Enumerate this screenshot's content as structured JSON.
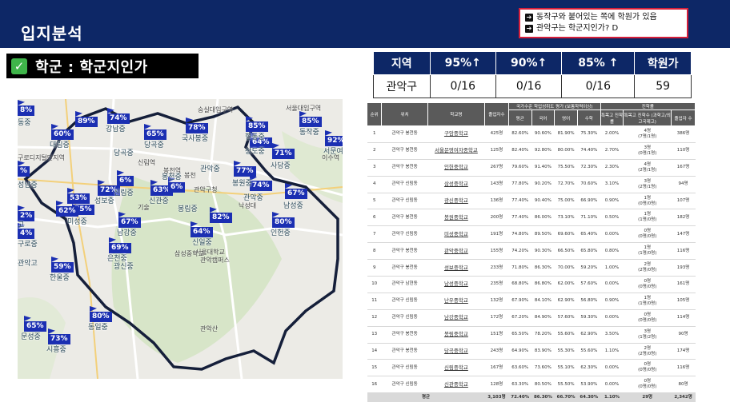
{
  "title": "입지분석",
  "notes": [
    "동작구와 붙어있는 쪽에 학원가 있음",
    "관악구는 학군지인가? D"
  ],
  "section": {
    "label": "학군 : 학군지인가"
  },
  "map": {
    "pins": [
      "8%",
      "89%",
      "74%",
      "60%",
      "65%",
      "78%",
      "85%",
      "85%",
      "92%",
      "64%",
      "71%",
      "77%",
      "72%",
      "63%",
      "6%",
      "74%",
      "67%",
      "53%",
      "75%",
      "62%",
      "67%",
      "82%",
      "80%",
      "64%",
      "69%",
      "59%",
      "65%",
      "80%",
      "73%",
      "4%",
      "2%",
      "%",
      "6%"
    ],
    "schools": [
      "동중",
      "대림중",
      "강남중",
      "당곡중",
      "국사봉중",
      "현동중",
      "성남중",
      "동작중",
      "상도중",
      "서문여",
      "사당중",
      "봉원중",
      "관악중",
      "신림중",
      "성보중",
      "신관중",
      "남성중",
      "미성중",
      "남강중",
      "구로중",
      "신일중",
      "은천중",
      "광신중",
      "인헌중",
      "한울중",
      "문성중",
      "동일중",
      "시흥중",
      "관악고",
      "고",
      "봉천중",
      "관악중",
      "봉림중",
      "당곡중"
    ],
    "labels": [
      "숭실대입구역",
      "서울대입구역",
      "신림역",
      "봉천역",
      "관악구청",
      "서울대학교",
      "관악캠퍼스",
      "삼성중학교",
      "관악산",
      "구로디지털단지역",
      "이수역",
      "낙성대",
      "봉천",
      "기술"
    ]
  },
  "summary": {
    "headers": [
      "지역",
      "95%↑",
      "90%↑",
      "85% ↑",
      "학원가"
    ],
    "row": [
      "관악구",
      "0/16",
      "0/16",
      "0/16",
      "59"
    ]
  },
  "detail": {
    "headers": [
      "순위",
      "위치",
      "학교명",
      "졸업자수",
      "평균",
      "국어",
      "영어",
      "수학",
      "특목고 진학률",
      "특목고 진학수 (과학고/외고국제고)",
      "졸업자 수"
    ],
    "group1": "국가수준 학업성취도 평가 (보통학력이상)",
    "group2": "진학률",
    "rows": [
      [
        "1",
        "관악구 봉천동",
        "구암중학교",
        "425명",
        "82.60%",
        "90.60%",
        "81.90%",
        "75.30%",
        "2.00%",
        "4명",
        "(7명/1명)",
        "386명"
      ],
      [
        "2",
        "관악구 봉천동",
        "서울문영여자중학교",
        "125명",
        "82.40%",
        "92.80%",
        "80.00%",
        "74.40%",
        "2.70%",
        "3명",
        "(0명/1명)",
        "110명"
      ],
      [
        "3",
        "관악구 봉천동",
        "인헌중학교",
        "267명",
        "79.60%",
        "91.40%",
        "75.50%",
        "72.30%",
        "2.30%",
        "4명",
        "(2명/1명)",
        "167명"
      ],
      [
        "4",
        "관악구 신림동",
        "삼성중학교",
        "143명",
        "77.80%",
        "90.20%",
        "72.70%",
        "70.60%",
        "3.10%",
        "3명",
        "(2명/1명)",
        "94명"
      ],
      [
        "5",
        "관악구 신림동",
        "광신중학교",
        "136명",
        "77.40%",
        "90.40%",
        "75.00%",
        "66.90%",
        "0.90%",
        "1명",
        "(0명/0명)",
        "107명"
      ],
      [
        "6",
        "관악구 봉천동",
        "봉원중학교",
        "200명",
        "77.40%",
        "86.00%",
        "73.10%",
        "71.10%",
        "0.50%",
        "1명",
        "(1명/0명)",
        "182명"
      ],
      [
        "7",
        "관악구 신림동",
        "미성중학교",
        "191명",
        "74.80%",
        "89.50%",
        "69.60%",
        "65.40%",
        "0.00%",
        "0명",
        "(0명/0명)",
        "147명"
      ],
      [
        "8",
        "관악구 봉천동",
        "관악중학교",
        "155명",
        "74.20%",
        "90.30%",
        "66.50%",
        "65.80%",
        "0.80%",
        "1명",
        "(1명/0명)",
        "116명"
      ],
      [
        "9",
        "관악구 봉천동",
        "성보중학교",
        "233명",
        "71.80%",
        "86.30%",
        "70.00%",
        "59.20%",
        "1.00%",
        "2명",
        "(2명/0명)",
        "193명"
      ],
      [
        "10",
        "관악구 남현동",
        "남성중학교",
        "235명",
        "68.80%",
        "86.80%",
        "62.00%",
        "57.60%",
        "0.00%",
        "0명",
        "(0명/0명)",
        "161명"
      ],
      [
        "11",
        "관악구 신림동",
        "난우중학교",
        "132명",
        "67.90%",
        "84.10%",
        "62.90%",
        "56.80%",
        "0.90%",
        "1명",
        "(1명/0명)",
        "105명"
      ],
      [
        "12",
        "관악구 신림동",
        "남강중학교",
        "172명",
        "67.20%",
        "84.90%",
        "57.60%",
        "59.30%",
        "0.00%",
        "0명",
        "(0명/0명)",
        "114명"
      ],
      [
        "13",
        "관악구 봉천동",
        "봉림중학교",
        "151명",
        "65.50%",
        "78.20%",
        "55.60%",
        "62.90%",
        "3.50%",
        "3명",
        "(1명/2명)",
        "90명"
      ],
      [
        "14",
        "관악구 봉천동",
        "당곡중학교",
        "243명",
        "64.90%",
        "83.90%",
        "55.30%",
        "55.60%",
        "1.10%",
        "2명",
        "(2명/0명)",
        "174명"
      ],
      [
        "15",
        "관악구 신림동",
        "신림중학교",
        "167명",
        "63.60%",
        "73.60%",
        "55.10%",
        "62.30%",
        "0.00%",
        "0명",
        "(0명/0명)",
        "116명"
      ],
      [
        "16",
        "관악구 신림동",
        "신관중학교",
        "128명",
        "63.30%",
        "80.50%",
        "55.50%",
        "53.90%",
        "0.00%",
        "0명",
        "(0명/0명)",
        "80명"
      ]
    ],
    "total": [
      "평균",
      "3,103명",
      "72.40%",
      "86.30%",
      "66.70%",
      "64.30%",
      "1.10%",
      "29명",
      "2,342명"
    ]
  }
}
